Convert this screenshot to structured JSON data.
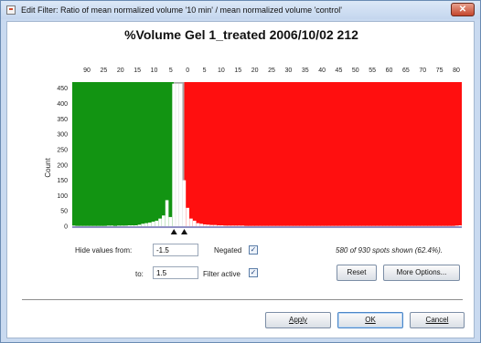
{
  "window": {
    "title": "Edit Filter: Ratio of mean normalized volume '10 min' / mean normalized volume 'control'",
    "close_glyph": "✕"
  },
  "chart_data": {
    "type": "bar",
    "title": "%Volume Gel 1_treated 2006/10/02 212",
    "ylabel": "Count",
    "top_ticks": [
      "90",
      "25",
      "20",
      "15",
      "10",
      "5",
      "0",
      "5",
      "10",
      "15",
      "20",
      "25",
      "30",
      "35",
      "40",
      "45",
      "50",
      "55",
      "60",
      "65",
      "70",
      "75",
      "80"
    ],
    "y_ticks": [
      0,
      50,
      100,
      150,
      200,
      250,
      300,
      350,
      400,
      450
    ],
    "ylim": [
      0,
      470
    ],
    "bins": [
      {
        "x": -30.5,
        "count": 2
      },
      {
        "x": -29.5,
        "count": 1
      },
      {
        "x": -28.5,
        "count": 1
      },
      {
        "x": -27.5,
        "count": 1
      },
      {
        "x": -26.5,
        "count": 1
      },
      {
        "x": -25.5,
        "count": 1
      },
      {
        "x": -24.5,
        "count": 1
      },
      {
        "x": -23.5,
        "count": 1
      },
      {
        "x": -22.5,
        "count": 1
      },
      {
        "x": -21.5,
        "count": 1
      },
      {
        "x": -20.5,
        "count": 2
      },
      {
        "x": -19.5,
        "count": 2
      },
      {
        "x": -18.5,
        "count": 1
      },
      {
        "x": -17.5,
        "count": 2
      },
      {
        "x": -16.5,
        "count": 2
      },
      {
        "x": -15.5,
        "count": 2
      },
      {
        "x": -14.5,
        "count": 3
      },
      {
        "x": -13.5,
        "count": 3
      },
      {
        "x": -12.5,
        "count": 3
      },
      {
        "x": -11.5,
        "count": 5
      },
      {
        "x": -10.5,
        "count": 8
      },
      {
        "x": -9.5,
        "count": 10
      },
      {
        "x": -8.5,
        "count": 12
      },
      {
        "x": -7.5,
        "count": 15
      },
      {
        "x": -6.5,
        "count": 18
      },
      {
        "x": -5.5,
        "count": 25
      },
      {
        "x": -4.5,
        "count": 35
      },
      {
        "x": -3.5,
        "count": 85
      },
      {
        "x": -2.5,
        "count": 30
      },
      {
        "x": -1.5,
        "count": 465
      },
      {
        "x": -0.5,
        "count": 465
      },
      {
        "x": 0.5,
        "count": 465
      },
      {
        "x": 1.5,
        "count": 150
      },
      {
        "x": 2.5,
        "count": 60
      },
      {
        "x": 3.5,
        "count": 25
      },
      {
        "x": 4.5,
        "count": 18
      },
      {
        "x": 5.5,
        "count": 10
      },
      {
        "x": 6.5,
        "count": 8
      },
      {
        "x": 7.5,
        "count": 6
      },
      {
        "x": 8.5,
        "count": 5
      },
      {
        "x": 9.5,
        "count": 4
      },
      {
        "x": 10.5,
        "count": 4
      },
      {
        "x": 11.5,
        "count": 3
      },
      {
        "x": 12.5,
        "count": 3
      },
      {
        "x": 13.5,
        "count": 2
      },
      {
        "x": 14.5,
        "count": 2
      },
      {
        "x": 15.5,
        "count": 2
      },
      {
        "x": 16.5,
        "count": 2
      },
      {
        "x": 17.5,
        "count": 2
      },
      {
        "x": 18.5,
        "count": 2
      },
      {
        "x": 19.5,
        "count": 1
      },
      {
        "x": 20.5,
        "count": 1
      },
      {
        "x": 21.5,
        "count": 1
      },
      {
        "x": 22.5,
        "count": 1
      },
      {
        "x": 23.5,
        "count": 1
      },
      {
        "x": 24.5,
        "count": 1
      },
      {
        "x": 25.5,
        "count": 1
      },
      {
        "x": 26.5,
        "count": 1
      },
      {
        "x": 27.5,
        "count": 1
      },
      {
        "x": 28.5,
        "count": 1
      },
      {
        "x": 29.5,
        "count": 1
      },
      {
        "x": 30.5,
        "count": 1
      },
      {
        "x": 31.5,
        "count": 1
      },
      {
        "x": 32.5,
        "count": 1
      },
      {
        "x": 33.5,
        "count": 1
      },
      {
        "x": 34.5,
        "count": 1
      },
      {
        "x": 35.5,
        "count": 1
      },
      {
        "x": 36.5,
        "count": 1
      },
      {
        "x": 37.5,
        "count": 1
      },
      {
        "x": 38.5,
        "count": 1
      },
      {
        "x": 39.5,
        "count": 1
      },
      {
        "x": 40.5,
        "count": 1
      },
      {
        "x": 41.5,
        "count": 1
      },
      {
        "x": 42.5,
        "count": 1
      },
      {
        "x": 43.5,
        "count": 1
      },
      {
        "x": 44.5,
        "count": 1
      },
      {
        "x": 45.5,
        "count": 1
      },
      {
        "x": 46.5,
        "count": 1
      },
      {
        "x": 47.5,
        "count": 1
      },
      {
        "x": 48.5,
        "count": 1
      },
      {
        "x": 49.5,
        "count": 1
      },
      {
        "x": 50.5,
        "count": 1
      },
      {
        "x": 51.5,
        "count": 1
      },
      {
        "x": 52.5,
        "count": 1
      },
      {
        "x": 53.5,
        "count": 1
      },
      {
        "x": 54.5,
        "count": 1
      },
      {
        "x": 55.5,
        "count": 1
      },
      {
        "x": 56.5,
        "count": 1
      },
      {
        "x": 57.5,
        "count": 1
      },
      {
        "x": 58.5,
        "count": 1
      },
      {
        "x": 59.5,
        "count": 1
      },
      {
        "x": 60.5,
        "count": 1
      },
      {
        "x": 61.5,
        "count": 1
      },
      {
        "x": 62.5,
        "count": 1
      },
      {
        "x": 63.5,
        "count": 1
      },
      {
        "x": 64.5,
        "count": 1
      },
      {
        "x": 65.5,
        "count": 1
      },
      {
        "x": 66.5,
        "count": 1
      },
      {
        "x": 67.5,
        "count": 1
      },
      {
        "x": 68.5,
        "count": 1
      },
      {
        "x": 69.5,
        "count": 1
      },
      {
        "x": 70.5,
        "count": 1
      },
      {
        "x": 71.5,
        "count": 1
      },
      {
        "x": 72.5,
        "count": 1
      },
      {
        "x": 73.5,
        "count": 1
      },
      {
        "x": 74.5,
        "count": 1
      },
      {
        "x": 75.5,
        "count": 1
      },
      {
        "x": 76.5,
        "count": 1
      },
      {
        "x": 77.5,
        "count": 1
      },
      {
        "x": 78.5,
        "count": 1
      },
      {
        "x": 79.5,
        "count": 1
      },
      {
        "x": 80.5,
        "count": 2
      },
      {
        "x": 81.5,
        "count": 3
      }
    ],
    "x_range": [
      -31,
      82
    ],
    "hide_region": [
      -1.5,
      1.5
    ],
    "colors": {
      "shown_low": "#129412",
      "shown_high": "#ff0f0f",
      "hidden": "#a8a8a8",
      "bar": "#ffffff",
      "axis": "#22228a"
    }
  },
  "controls": {
    "hide_from_label": "Hide values from:",
    "hide_from_value": "-1.5",
    "to_label": "to:",
    "to_value": "1.5",
    "negated_label": "Negated",
    "negated_checked": "✓",
    "filter_active_label": "Filter active",
    "filter_active_checked": "✓",
    "spots_shown": "580 of 930 spots shown (62.4%).",
    "reset_label": "Reset",
    "more_options_label": "More Options...",
    "apply_label": "Apply",
    "ok_label": "OK",
    "cancel_label": "Cancel"
  }
}
